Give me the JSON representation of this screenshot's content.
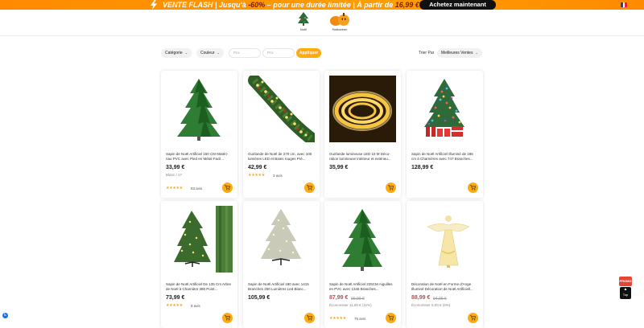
{
  "banner": {
    "flash_label": "VENTE FLASH",
    "sep1": " | Jusqu'à ",
    "discount": "-60%",
    "middle": " – pour une durée limitée | À partir de ",
    "from_price": "16,99 €",
    "cta": "Achetez maintenant",
    "bg_color": "#ff9400"
  },
  "categories": [
    {
      "label": "Noël",
      "icon": "christmas-tree-icon"
    },
    {
      "label": "Halloween",
      "icon": "pumpkin-icon"
    }
  ],
  "filters": {
    "category": "Catégorie",
    "color": "Couleur",
    "price_min_placeholder": "Prix",
    "price_min_currency": "Prix doliar",
    "price_max_placeholder": "Prix",
    "price_max_currency": "Prix doliar",
    "apply": "Appliquer",
    "sort_label": "Trier Par",
    "sort_value": "Meilleures Ventes"
  },
  "products": [
    {
      "title": "Sapin de Noël Artificiel 150 CM Matéri­riau PVC avec Pied en Métal Facil...",
      "price": "33,99 €",
      "old_price": "",
      "sub": "Blanc / 17",
      "stars": "★★★★★",
      "reviews": "83 avis"
    },
    {
      "title": "Guirlande de Noël de 270 cm, avec 100 lumières LED et Baies rouges Pré...",
      "price": "42,99 €",
      "old_price": "",
      "sub": "",
      "stars": "★★★★★",
      "reviews": "3 avis"
    },
    {
      "title": "Guirlande lumineuse LED 15 M Déco­ration lumineuse intérieur et extérieu...",
      "price": "35,99 €",
      "old_price": "",
      "sub": "",
      "stars": "",
      "reviews": ""
    },
    {
      "title": "Sapin de Noël Artificiel Illuminé de 185 cm à Charnières avec 747 Branches...",
      "price": "128,99 €",
      "old_price": "",
      "sub": "",
      "stars": "",
      "reviews": ""
    },
    {
      "title": "Sapin de Noël Artificiel De 135 Cm Arbre de Noël à Charnière 386 Point...",
      "price": "73,99 €",
      "old_price": "",
      "sub": "",
      "stars": "★★★★★",
      "reviews": "8 avis"
    },
    {
      "title": "Sapin de Noël Artificiel 180 avec 1415 Branches 250 Lumières Led Blanc...",
      "price": "105,99 €",
      "old_price": "",
      "sub": "",
      "stars": "",
      "reviews": ""
    },
    {
      "title": "Sapin de Noël Artificiel 225CM Ai­guilles en PVC avec 1346 Branches...",
      "price": "87,99 €",
      "old_price": "99,99 €",
      "sub": "Économiser 11,00 € (11%)",
      "stars": "★★★★★",
      "reviews": "75 avis"
    },
    {
      "title": "Décoration de Noël en Forme d'Ange Illuminé Décoration de Noël Artificiell...",
      "price": "88,99 €",
      "old_price": "94,99 €",
      "sub": "Économiser 6,00 € (6%)",
      "stars": "",
      "reviews": ""
    }
  ],
  "widgets": {
    "promo": "PROMO",
    "top": "Top"
  },
  "colors": {
    "accent": "#ffab0f",
    "sale": "#e53b3b",
    "star": "#f5a623"
  }
}
